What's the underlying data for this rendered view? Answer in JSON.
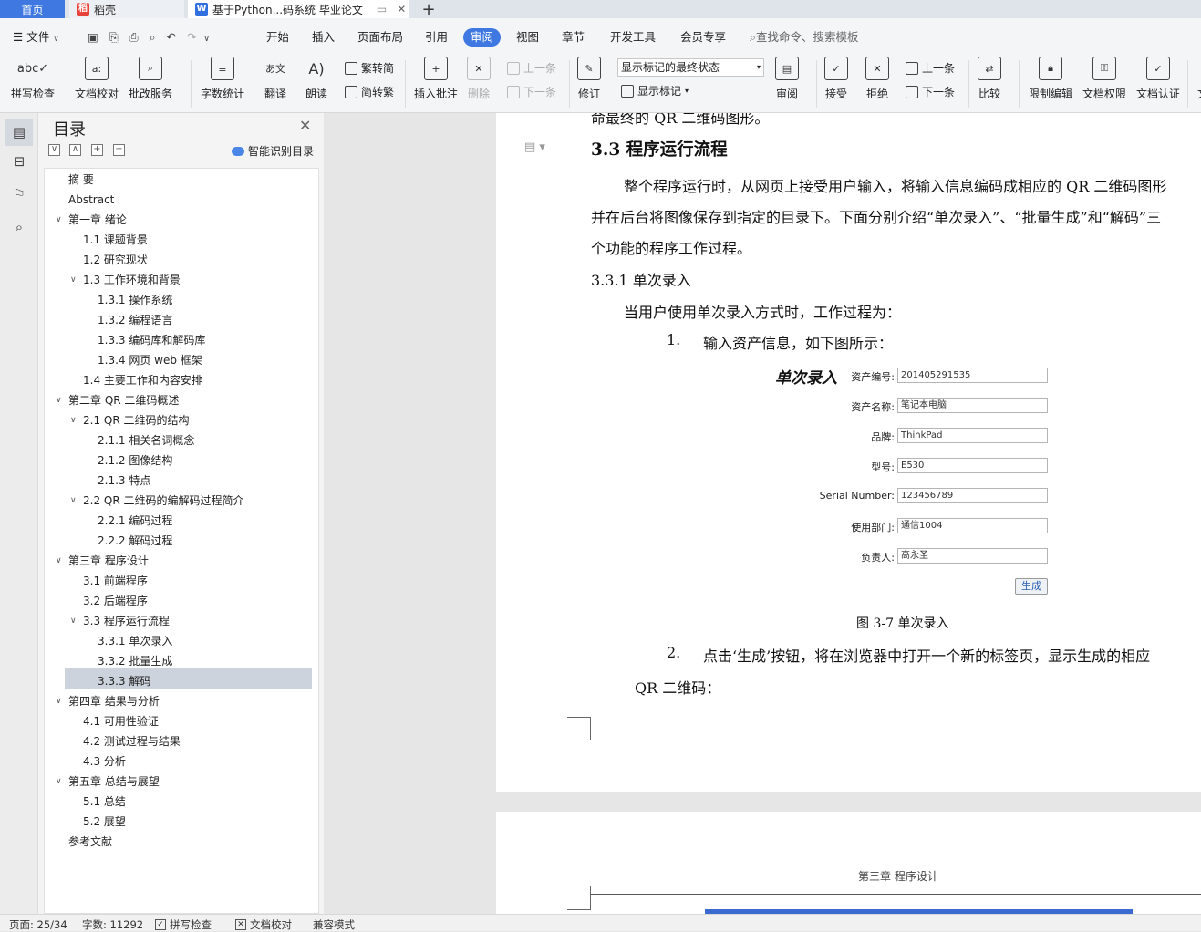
{
  "tabs": {
    "home": "首页",
    "daoke": "稻壳",
    "doc": "基于Python...码系统 毕业论文",
    "add": "+"
  },
  "menu": {
    "file": "文件",
    "items": [
      "开始",
      "插入",
      "页面布局",
      "引用",
      "审阅",
      "视图",
      "章节",
      "开发工具",
      "会员专享"
    ],
    "search": "查找命令、搜索模板"
  },
  "ribbon": {
    "spell_check": "拼写检查",
    "doc_proof": "文档校对",
    "batch_service": "批改服务",
    "word_count": "字数统计",
    "translate": "翻译",
    "read_aloud": "朗读",
    "to_traditional": "繁转简",
    "to_simplified": "简转繁",
    "insert_comment": "插入批注",
    "delete": "删除",
    "prev_comment": "上一条",
    "next_comment": "下一条",
    "revise": "修订",
    "markup_select": "显示标记的最终状态",
    "show_markup": "显示标记",
    "review": "审阅",
    "accept": "接受",
    "reject": "拒绝",
    "prev_change": "上一条",
    "next_change": "下一条",
    "compare": "比较",
    "restrict_edit": "限制编辑",
    "doc_permission": "文档权限",
    "doc_certify": "文档认证",
    "more": "文"
  },
  "toc": {
    "title": "目录",
    "smart": "智能识别目录",
    "items": [
      {
        "label": "摘    要",
        "level": 0,
        "arrow": false
      },
      {
        "label": "Abstract",
        "level": 0,
        "arrow": false
      },
      {
        "label": "第一章    绪论",
        "level": 0,
        "arrow": true
      },
      {
        "label": "1.1    课题背景",
        "level": 1,
        "arrow": false
      },
      {
        "label": "1.2    研究现状",
        "level": 1,
        "arrow": false
      },
      {
        "label": "1.3    工作环境和背景",
        "level": 1,
        "arrow": true
      },
      {
        "label": "1.3.1  操作系统",
        "level": 2,
        "arrow": false
      },
      {
        "label": "1.3.2  编程语言",
        "level": 2,
        "arrow": false
      },
      {
        "label": "1.3.3 编码库和解码库",
        "level": 2,
        "arrow": false
      },
      {
        "label": "1.3.4  网页 web 框架",
        "level": 2,
        "arrow": false
      },
      {
        "label": "1.4    主要工作和内容安排",
        "level": 1,
        "arrow": false
      },
      {
        "label": "第二章    QR 二维码概述",
        "level": 0,
        "arrow": true
      },
      {
        "label": "2.1    QR 二维码的结构",
        "level": 1,
        "arrow": true
      },
      {
        "label": "2.1.1  相关名词概念",
        "level": 2,
        "arrow": false
      },
      {
        "label": "2.1.2    图像结构",
        "level": 2,
        "arrow": false
      },
      {
        "label": "2.1.3    特点",
        "level": 2,
        "arrow": false
      },
      {
        "label": "2.2    QR 二维码的编解码过程简介",
        "level": 1,
        "arrow": true
      },
      {
        "label": "2.2.1    编码过程",
        "level": 2,
        "arrow": false
      },
      {
        "label": "2.2.2    解码过程",
        "level": 2,
        "arrow": false
      },
      {
        "label": "第三章    程序设计",
        "level": 0,
        "arrow": true
      },
      {
        "label": "3.1  前端程序",
        "level": 1,
        "arrow": false
      },
      {
        "label": "3.2  后端程序",
        "level": 1,
        "arrow": false
      },
      {
        "label": "3.3  程序运行流程",
        "level": 1,
        "arrow": true
      },
      {
        "label": "3.3.1  单次录入",
        "level": 2,
        "arrow": false
      },
      {
        "label": "3.3.2  批量生成",
        "level": 2,
        "arrow": false
      },
      {
        "label": "3.3.3  解码",
        "level": 2,
        "arrow": false
      },
      {
        "label": "第四章  结果与分析",
        "level": 0,
        "arrow": true
      },
      {
        "label": "4.1  可用性验证",
        "level": 1,
        "arrow": false
      },
      {
        "label": "4.2  测试过程与结果",
        "level": 1,
        "arrow": false
      },
      {
        "label": "4.3  分析",
        "level": 1,
        "arrow": false
      },
      {
        "label": "第五章  总结与展望",
        "level": 0,
        "arrow": true
      },
      {
        "label": "5.1  总结",
        "level": 1,
        "arrow": false
      },
      {
        "label": "5.2  展望",
        "level": 1,
        "arrow": false
      },
      {
        "label": "参考文献",
        "level": 0,
        "arrow": false
      }
    ],
    "selected_index": 22
  },
  "doc": {
    "cut_line": "命最终的 QR 二维码图形。",
    "heading": "3.3  程序运行流程",
    "para1_l1": "整个程序运行时，从网页上接受用户输入，将输入信息编码成相应的 QR 二维码图形",
    "para1_l2": "并在后台将图像保存到指定的目录下。下面分别介绍“单次录入”、“批量生成”和“解码”三",
    "para1_l3": "个功能的程序工作过程。",
    "subheading": "3.3.1  单次录入",
    "para2": "当用户使用单次录入方式时，工作过程为：",
    "step1_num": "1.",
    "step1": "输入资产信息，如下图所示：",
    "form": {
      "title": "单次录入",
      "fields": [
        {
          "label": "资产编号:",
          "value": "201405291535"
        },
        {
          "label": "资产名称:",
          "value": "笔记本电脑"
        },
        {
          "label": "品牌:",
          "value": "ThinkPad"
        },
        {
          "label": "型号:",
          "value": "E530"
        },
        {
          "label": "Serial Number:",
          "value": "123456789"
        },
        {
          "label": "使用部门:",
          "value": "通信1004"
        },
        {
          "label": "负责人:",
          "value": "高永圣"
        }
      ],
      "button": "生成"
    },
    "caption": "图 3-7 单次录入",
    "step2_num": "2.",
    "step2": "点击‘生成’按钮，将在浏览器中打开一个新的标签页，显示生成的相应",
    "step2_l2": "QR 二维码：",
    "page2_header": "第三章  程序设计"
  },
  "status": {
    "page": "页面: 25/34",
    "words": "字数: 11292",
    "spell": "拼写检查",
    "proof": "文档校对",
    "compat": "兼容模式"
  },
  "colors": {
    "accent": "#3f78e0"
  }
}
